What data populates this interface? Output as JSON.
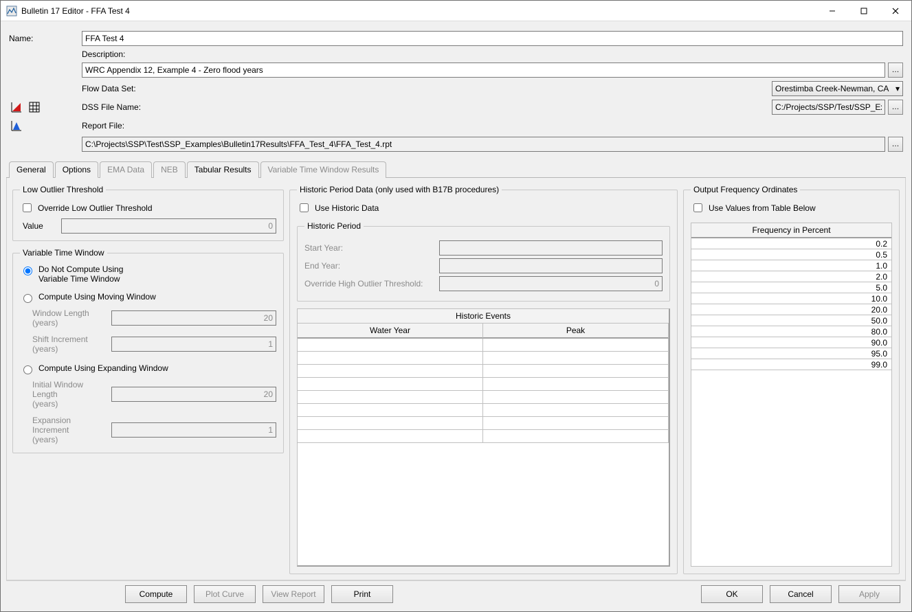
{
  "window": {
    "title": "Bulletin 17 Editor - FFA Test 4"
  },
  "form": {
    "name_label": "Name:",
    "name_value": "FFA Test 4",
    "desc_label": "Description:",
    "desc_value": "WRC Appendix 12, Example 4 - Zero flood years",
    "flowds_label": "Flow Data Set:",
    "flowds_value": "Orestimba Creek-Newman, CA",
    "dss_label": "DSS File Name:",
    "dss_value": "C:/Projects/SSP/Test/SSP_Examples/SSP_EXAMPLES.dss",
    "report_label": "Report File:",
    "report_value": "C:\\Projects\\SSP\\Test\\SSP_Examples\\Bulletin17Results\\FFA_Test_4\\FFA_Test_4.rpt"
  },
  "tabs": {
    "general": "General",
    "options": "Options",
    "ema": "EMA Data",
    "neb": "NEB",
    "tabular": "Tabular Results",
    "vtw": "Variable Time Window Results"
  },
  "outlier": {
    "legend": "Low Outlier Threshold",
    "override_label": "Override Low Outlier Threshold",
    "value_label": "Value",
    "value": "0"
  },
  "vtw": {
    "legend": "Variable Time Window",
    "opt_none": "Do Not Compute Using\nVariable Time Window",
    "opt_moving": "Compute Using Moving Window",
    "wl_label": "Window Length\n(years)",
    "wl_value": "20",
    "shift_label": "Shift Increment\n(years)",
    "shift_value": "1",
    "opt_expand": "Compute Using Expanding Window",
    "iwl_label": "Initial Window Length\n(years)",
    "iwl_value": "20",
    "exp_label": "Expansion Increment\n(years)",
    "exp_value": "1"
  },
  "historic": {
    "legend": "Historic Period Data (only used with B17B procedures)",
    "use_label": "Use Historic Data",
    "period_legend": "Historic Period",
    "start_label": "Start Year:",
    "end_label": "End Year:",
    "oho_label": "Override High Outlier Threshold:",
    "oho_value": "0",
    "events_title": "Historic Events",
    "col_water_year": "Water Year",
    "col_peak": "Peak"
  },
  "freq": {
    "legend": "Output Frequency Ordinates",
    "use_label": "Use Values from Table Below",
    "header": "Frequency in Percent",
    "values": [
      "0.2",
      "0.5",
      "1.0",
      "2.0",
      "5.0",
      "10.0",
      "20.0",
      "50.0",
      "80.0",
      "90.0",
      "95.0",
      "99.0"
    ]
  },
  "buttons": {
    "compute": "Compute",
    "plot_curve": "Plot Curve",
    "view_report": "View Report",
    "print": "Print",
    "ok": "OK",
    "cancel": "Cancel",
    "apply": "Apply"
  }
}
